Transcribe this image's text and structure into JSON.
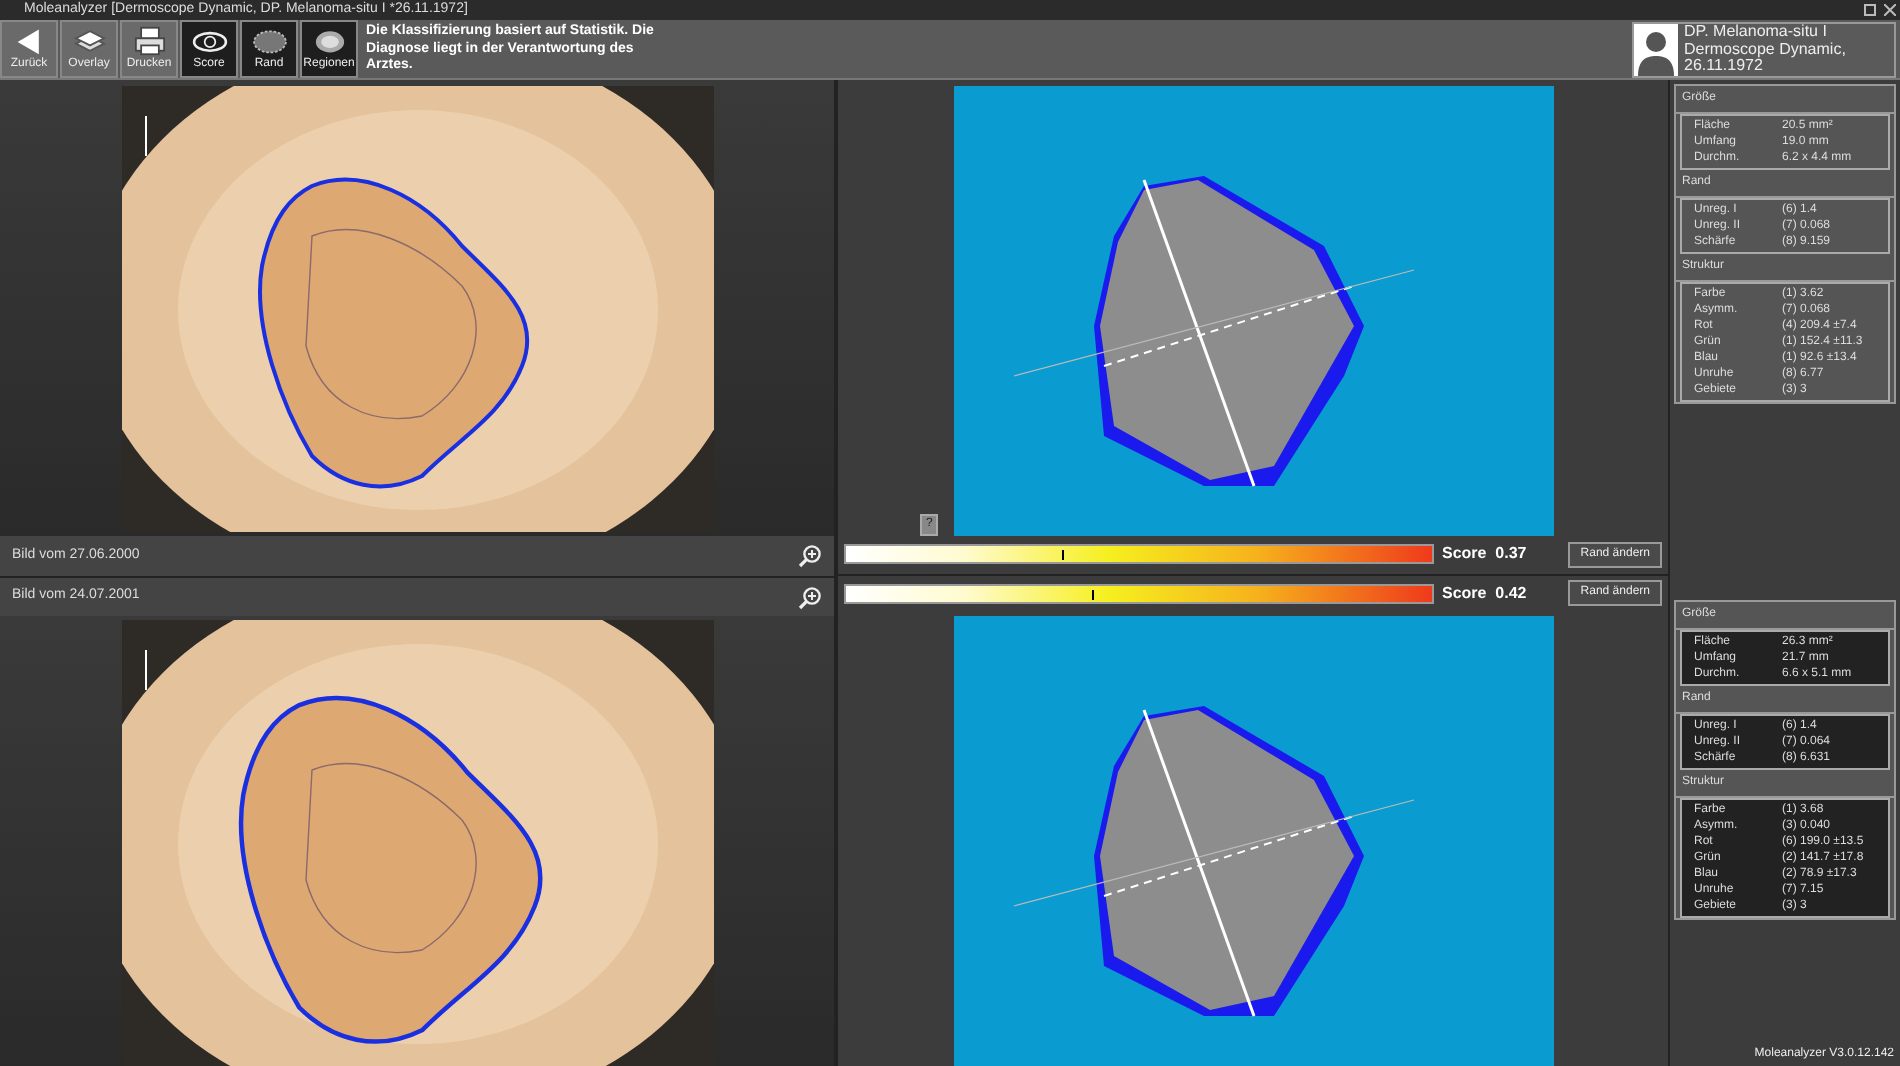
{
  "window": {
    "title": "Moleanalyzer  [Dermoscope Dynamic, DP. Melanoma-situ I  *26.11.1972]"
  },
  "toolbar": [
    {
      "kind": "back",
      "label": "Zurück",
      "selected": false
    },
    {
      "kind": "overlay",
      "label": "Overlay",
      "selected": false
    },
    {
      "kind": "print",
      "label": "Drucken",
      "selected": false
    },
    {
      "kind": "eye",
      "label": "Score",
      "selected": true
    },
    {
      "kind": "border",
      "label": "Rand",
      "selected": true
    },
    {
      "kind": "regions",
      "label": "Regionen",
      "selected": true
    }
  ],
  "notice": "Die Klassifizierung basiert auf Statistik. Die Diagnose liegt in der Verantwortung des Arztes.",
  "patient": {
    "lines": [
      "DP. Melanoma-situ I",
      "Dermoscope Dynamic,",
      "26.11.1972"
    ]
  },
  "exams": [
    {
      "date": "Bild vom 27.06.2000",
      "help": "?",
      "score_label": "Score",
      "score": "0.37",
      "level": 0.37,
      "button": "Rand ändern",
      "stats": [
        {
          "title": "Größe",
          "rows": [
            {
              "label": "Fläche",
              "value": "20.5 mm²"
            },
            {
              "label": "Umfang",
              "value": "19.0 mm"
            },
            {
              "label": "Durchm.",
              "value": "6.2 x 4.4 mm"
            }
          ]
        },
        {
          "title": "Rand",
          "rows": [
            {
              "label": "Unreg. I",
              "value": "(6) 1.4"
            },
            {
              "label": "Unreg. II",
              "value": "(7) 0.068"
            },
            {
              "label": "Schärfe",
              "value": "(8) 9.159"
            }
          ]
        },
        {
          "title": "Struktur",
          "rows": [
            {
              "label": "Farbe",
              "value": "(1) 3.62"
            },
            {
              "label": "Asymm.",
              "value": "(7) 0.068"
            },
            {
              "label": "Rot",
              "value": "(4) 209.4  ±7.4"
            },
            {
              "label": "Grün",
              "value": "(1) 152.4  ±11.3"
            },
            {
              "label": "Blau",
              "value": "(1) 92.6  ±13.4"
            },
            {
              "label": "Unruhe",
              "value": "(8) 6.77"
            },
            {
              "label": "Gebiete",
              "value": "(3) 3"
            }
          ]
        }
      ]
    },
    {
      "date": "Bild vom 24.07.2001",
      "score_label": "Score",
      "score": "0.42",
      "level": 0.42,
      "button": "Rand ändern",
      "stats": [
        {
          "title": "Größe",
          "rows": [
            {
              "label": "Fläche",
              "value": "26.3 mm²"
            },
            {
              "label": "Umfang",
              "value": "21.7 mm"
            },
            {
              "label": "Durchm.",
              "value": "6.6 x 5.1 mm"
            }
          ]
        },
        {
          "title": "Rand",
          "rows": [
            {
              "label": "Unreg. I",
              "value": "(6) 1.4"
            },
            {
              "label": "Unreg. II",
              "value": "(7) 0.064"
            },
            {
              "label": "Schärfe",
              "value": "(8) 6.631"
            }
          ]
        },
        {
          "title": "Struktur",
          "rows": [
            {
              "label": "Farbe",
              "value": "(1) 3.68"
            },
            {
              "label": "Asymm.",
              "value": "(3) 0.040"
            },
            {
              "label": "Rot",
              "value": "(6) 199.0  ±13.5"
            },
            {
              "label": "Grün",
              "value": "(2) 141.7  ±17.8"
            },
            {
              "label": "Blau",
              "value": "(2) 78.9  ±17.3"
            },
            {
              "label": "Unruhe",
              "value": "(7) 7.15"
            },
            {
              "label": "Gebiete",
              "value": "(3) 3"
            }
          ]
        }
      ]
    }
  ],
  "status_bar": {
    "version": "Moleanalyzer V3.0.12.142"
  }
}
